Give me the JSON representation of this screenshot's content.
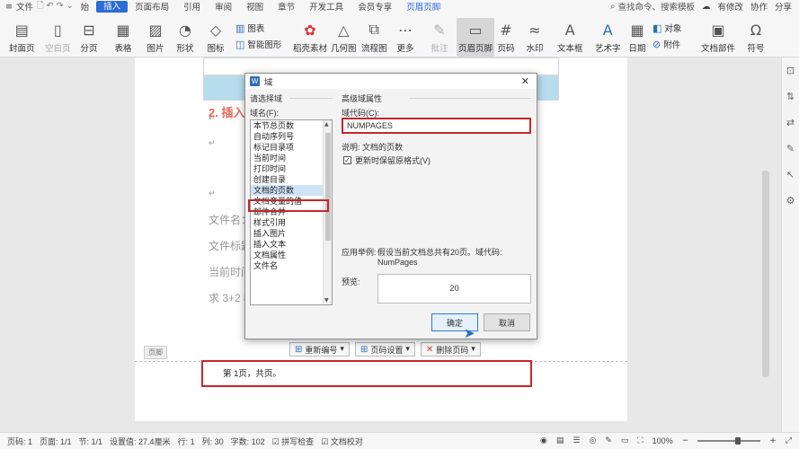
{
  "menubar": {
    "menu_label": "文件",
    "tabs": [
      "始",
      "插入",
      "页面布局",
      "引用",
      "审阅",
      "视图",
      "章节",
      "开发工具",
      "会员专享",
      "页眉页脚"
    ],
    "active_tab_index": 1,
    "search_placeholder": "查找命令、搜索模板",
    "right_items": [
      "有修改",
      "协作",
      "分享"
    ]
  },
  "ribbon": {
    "items": [
      {
        "label": "封面页",
        "icon": "cover-page-icon"
      },
      {
        "label": "空白页",
        "icon": "blank-page-icon"
      },
      {
        "label": "分页",
        "icon": "page-break-icon"
      },
      {
        "label": "表格",
        "icon": "table-icon"
      },
      {
        "label": "图片",
        "icon": "picture-icon"
      },
      {
        "label": "形状",
        "icon": "shape-icon"
      },
      {
        "label": "图标",
        "icon": "icon-lib-icon"
      },
      {
        "label": "稻壳素材",
        "icon": "material-icon"
      },
      {
        "label": "几何图",
        "icon": "geometry-icon"
      },
      {
        "label": "流程图",
        "icon": "flowchart-icon"
      },
      {
        "label": "更多",
        "icon": "more-icon"
      },
      {
        "label": "批注",
        "icon": "comment-icon"
      },
      {
        "label": "页眉页脚",
        "icon": "header-footer-icon"
      },
      {
        "label": "页码",
        "icon": "page-number-icon"
      },
      {
        "label": "水印",
        "icon": "watermark-icon"
      },
      {
        "label": "文本框",
        "icon": "textbox-icon"
      },
      {
        "label": "艺术字",
        "icon": "wordart-icon"
      },
      {
        "label": "日期",
        "icon": "date-icon"
      },
      {
        "label": "文档部件",
        "icon": "doc-parts-icon"
      },
      {
        "label": "符号",
        "icon": "symbol-icon"
      }
    ],
    "small": {
      "chart": "图表",
      "smart_graphic": "智能图形",
      "object": "对象",
      "attachment": "附件"
    }
  },
  "document": {
    "heading": "2. 插入",
    "lines": [
      "文件名：",
      "文件标题",
      "当前时间",
      "求 3+2 8"
    ],
    "footer_tag": "页脚",
    "footer_text": "第 1页，共页。",
    "footer_tools": [
      "重新编号",
      "页码设置",
      "删除页码"
    ]
  },
  "dialog": {
    "title": "域",
    "left_group": "请选择域",
    "field_name_label": "域名(F):",
    "field_names": [
      "本节总页数",
      "自动序列号",
      "标记目录项",
      "当前时间",
      "打印时间",
      "创建目录",
      "文档的页数",
      "文档变量的值",
      "邮件合并",
      "样式引用",
      "插入图片",
      "插入文本",
      "文档属性",
      "文件名"
    ],
    "selected_index": 6,
    "right_group": "高级域属性",
    "code_label": "域代码(C):",
    "code_value": "NUMPAGES",
    "description": "说明: 文档的页数",
    "keep_format_label": "更新时保留原格式(V)",
    "keep_format_checked": true,
    "example_label": "应用举例:",
    "example_text": "假设当前文档总共有20页。域代码:",
    "example_code": "NumPages",
    "preview_label": "预览:",
    "preview_value": "20",
    "ok_label": "确定",
    "cancel_label": "取消"
  },
  "statusbar": {
    "page_code": "页码: 1",
    "page": "页面: 1/1",
    "section": "节: 1/1",
    "position": "设置值: 27.4厘米",
    "row": "行: 1",
    "col": "列: 30",
    "words": "字数: 102",
    "spell": "拼写检查",
    "proof": "文档校对",
    "zoom": "100%"
  }
}
